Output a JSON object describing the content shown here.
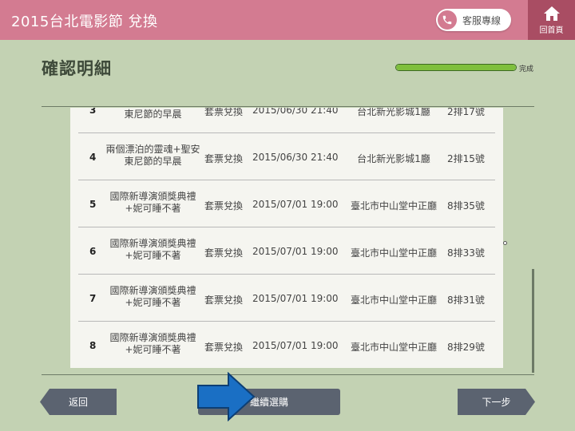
{
  "header": {
    "title": "2015台北電影節 兌換",
    "service_label": "客服專線",
    "home_label": "回首頁"
  },
  "page": {
    "title": "確認明細",
    "progress_label": "完成",
    "progress_fraction": 1.0
  },
  "rows": [
    {
      "no": "3",
      "title": "兩個漂泊的靈魂+聖安東尼節的早晨",
      "type": "套票兌換",
      "time": "2015/06/30 21:40",
      "venue": "台北新光影城1廳",
      "seat": "2排17號"
    },
    {
      "no": "4",
      "title": "兩個漂泊的靈魂+聖安東尼節的早晨",
      "type": "套票兌換",
      "time": "2015/06/30 21:40",
      "venue": "台北新光影城1廳",
      "seat": "2排15號"
    },
    {
      "no": "5",
      "title": "國際新導演頒獎典禮+妮可睡不著",
      "type": "套票兌換",
      "time": "2015/07/01 19:00",
      "venue": "臺北市中山堂中正廳",
      "seat": "8排35號"
    },
    {
      "no": "6",
      "title": "國際新導演頒獎典禮+妮可睡不著",
      "type": "套票兌換",
      "time": "2015/07/01 19:00",
      "venue": "臺北市中山堂中正廳",
      "seat": "8排33號"
    },
    {
      "no": "7",
      "title": "國際新導演頒獎典禮+妮可睡不著",
      "type": "套票兌換",
      "time": "2015/07/01 19:00",
      "venue": "臺北市中山堂中正廳",
      "seat": "8排31號"
    },
    {
      "no": "8",
      "title": "國際新導演頒獎典禮+妮可睡不著",
      "type": "套票兌換",
      "time": "2015/07/01 19:00",
      "venue": "臺北市中山堂中正廳",
      "seat": "8排29號"
    }
  ],
  "footer": {
    "back_label": "返回",
    "continue_label": "繼續選購",
    "next_label": "下一步"
  },
  "icons": {
    "phone": "phone-icon",
    "home": "home-icon",
    "arrow": "arrow-right-icon"
  },
  "colors": {
    "header": "#d37b91",
    "home": "#a94d63",
    "background": "#c3d2b3",
    "button": "#5b6370",
    "progress": "#7fbf3d",
    "arrow": "#1a6fc4"
  }
}
